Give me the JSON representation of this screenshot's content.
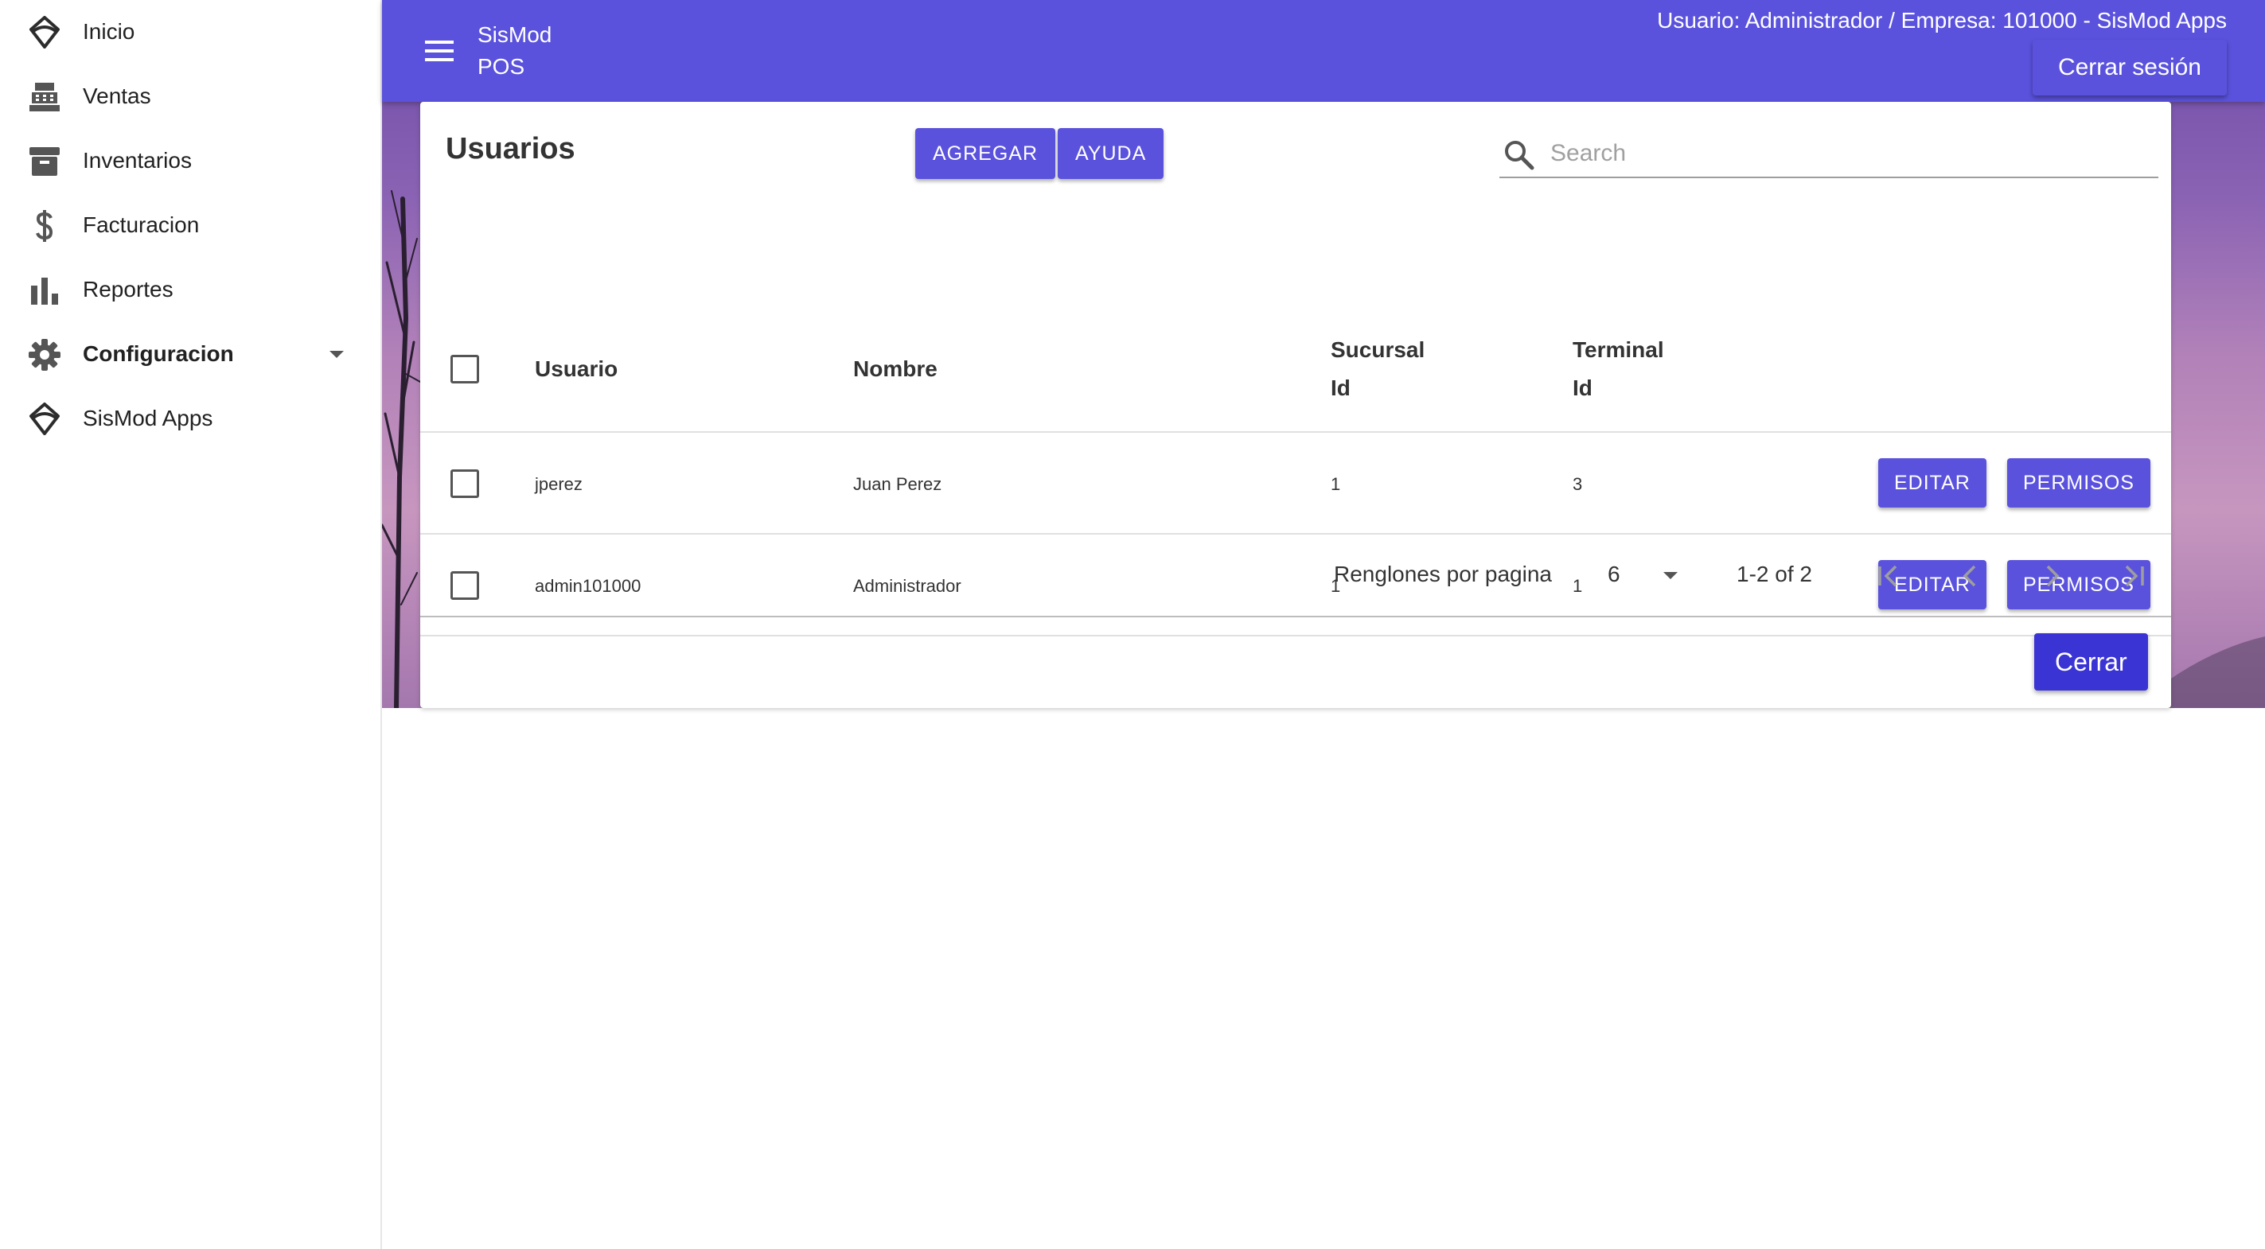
{
  "sidebar": {
    "items": [
      {
        "label": "Inicio",
        "icon": "sismod-logo-icon"
      },
      {
        "label": "Ventas",
        "icon": "cash-register-icon"
      },
      {
        "label": "Inventarios",
        "icon": "archive-box-icon"
      },
      {
        "label": "Facturacion",
        "icon": "dollar-icon"
      },
      {
        "label": "Reportes",
        "icon": "bar-chart-icon"
      },
      {
        "label": "Configuracion",
        "icon": "gear-icon"
      },
      {
        "label": "SisMod Apps",
        "icon": "sismod-logo-icon"
      }
    ]
  },
  "header": {
    "brand_line1": "SisMod",
    "brand_line2": "POS",
    "session_info": "Usuario: Administrador / Empresa: 101000 - SisMod Apps",
    "logout_label": "Cerrar sesión"
  },
  "card": {
    "title": "Usuarios",
    "add_label": "AGREGAR",
    "help_label": "AYUDA",
    "search_placeholder": "Search"
  },
  "table": {
    "headers": {
      "usuario": "Usuario",
      "nombre": "Nombre",
      "sucursal_line1": "Sucursal",
      "sucursal_line2": "Id",
      "terminal_line1": "Terminal",
      "terminal_line2": "Id"
    },
    "rows": [
      {
        "usuario": "jperez",
        "nombre": "Juan Perez",
        "sucursal": "1",
        "terminal": "3",
        "edit_label": "EDITAR",
        "perms_label": "PERMISOS"
      },
      {
        "usuario": "admin101000",
        "nombre": "Administrador",
        "sucursal": "1",
        "terminal": "1",
        "edit_label": "EDITAR",
        "perms_label": "PERMISOS"
      }
    ]
  },
  "pagination": {
    "rows_per_page_label": "Renglones por pagina",
    "rows_per_page_value": "6",
    "range": "1-2 of 2"
  },
  "footer": {
    "close_label": "Cerrar"
  },
  "colors": {
    "primary": "#5a52dc",
    "close_button": "#3b34d4"
  }
}
